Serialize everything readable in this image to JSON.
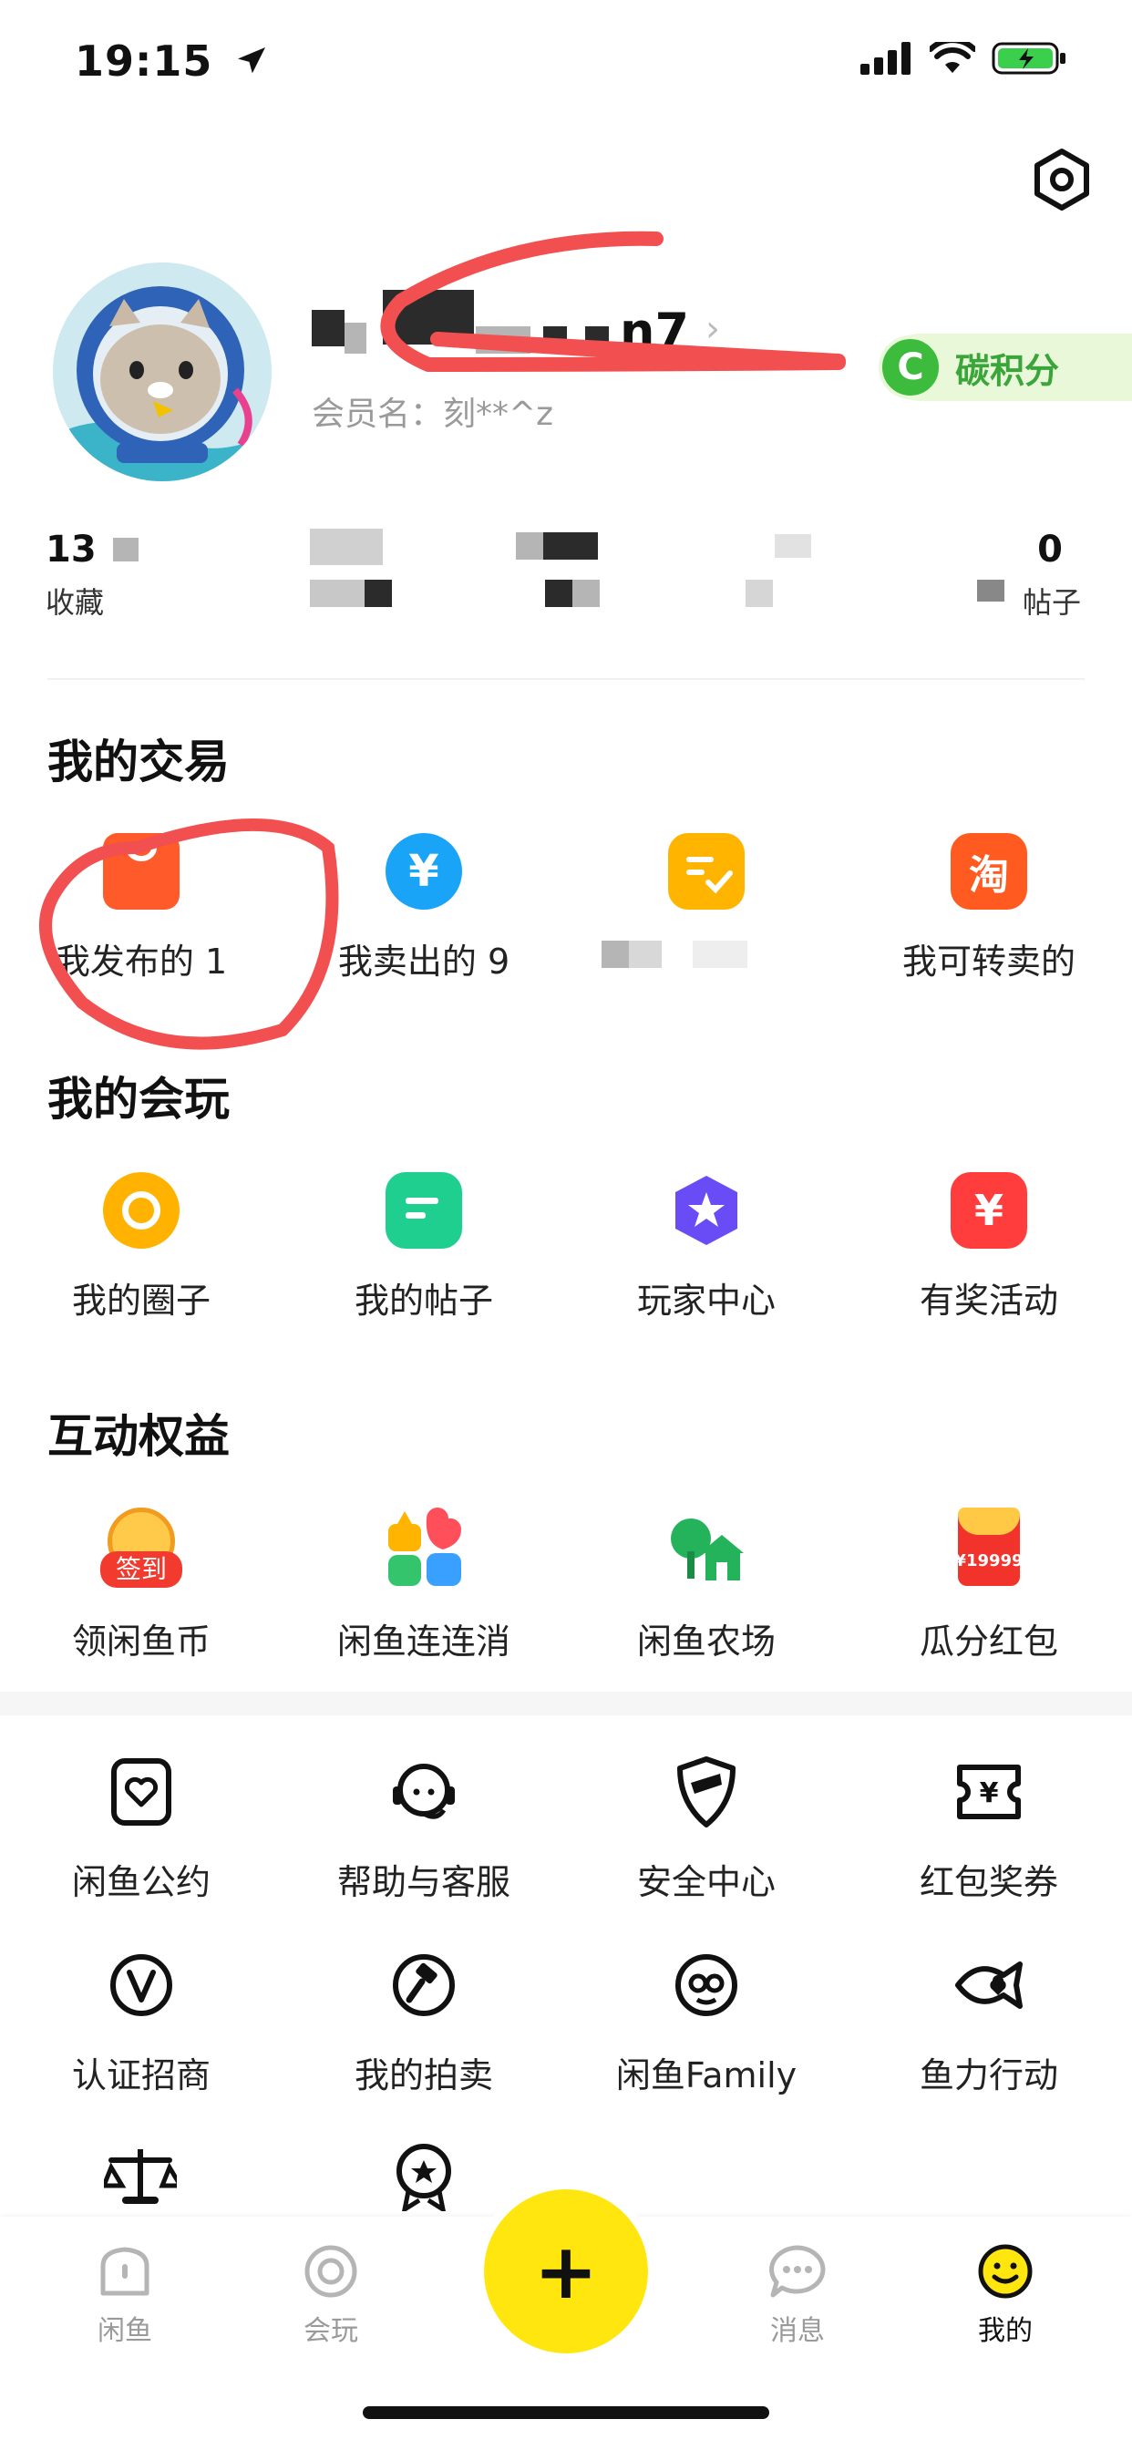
{
  "status_bar": {
    "time": "19:15"
  },
  "profile": {
    "username_visible": "n7",
    "member_name": "会员名：刻**^z",
    "carbon_badge": {
      "icon_letter": "C",
      "label": "碳积分"
    }
  },
  "stats": [
    {
      "num": "13",
      "label": "收藏"
    },
    {
      "num": "",
      "label": ""
    },
    {
      "num": "",
      "label": ""
    },
    {
      "num": "",
      "label": ""
    },
    {
      "num": "0",
      "label": "帖子"
    }
  ],
  "trade": {
    "title": "我的交易",
    "items": [
      {
        "label": "我发布的 1",
        "icon": "bag-icon",
        "color": "#ff5a2a"
      },
      {
        "label": "我卖出的 9",
        "icon": "yen-circle-icon",
        "color": "#1aa4f7"
      },
      {
        "label": "",
        "icon": "checklist-icon",
        "color": "#ffb400"
      },
      {
        "label": "我可转卖的",
        "icon": "taobao-icon",
        "color": "#ff5a1f"
      }
    ]
  },
  "play": {
    "title": "我的会玩",
    "items": [
      {
        "label": "我的圈子",
        "icon": "circle-icon",
        "color": "#ffb300"
      },
      {
        "label": "我的帖子",
        "icon": "post-icon",
        "color": "#1fcf8f"
      },
      {
        "label": "玩家中心",
        "icon": "star-badge-icon",
        "color": "#6a4cf6"
      },
      {
        "label": "有奖活动",
        "icon": "prize-icon",
        "color": "#ff3d3d"
      }
    ]
  },
  "benefits": {
    "title": "互动权益",
    "items": [
      {
        "label": "领闲鱼币",
        "icon": "checkin-coin-icon",
        "badge": "签到"
      },
      {
        "label": "闲鱼连连消",
        "icon": "game-tiles-icon"
      },
      {
        "label": "闲鱼农场",
        "icon": "farm-icon"
      },
      {
        "label": "瓜分红包",
        "icon": "red-envelope-icon",
        "badge": "¥19999"
      }
    ]
  },
  "services": {
    "items": [
      {
        "label": "闲鱼公约",
        "icon": "heart-doc-icon"
      },
      {
        "label": "帮助与客服",
        "icon": "headset-icon"
      },
      {
        "label": "安全中心",
        "icon": "shield-icon"
      },
      {
        "label": "红包奖券",
        "icon": "coupon-icon"
      },
      {
        "label": "认证招商",
        "icon": "verified-v-icon"
      },
      {
        "label": "我的拍卖",
        "icon": "auction-hammer-icon"
      },
      {
        "label": "闲鱼Family",
        "icon": "family-icon"
      },
      {
        "label": "鱼力行动",
        "icon": "fish-icon"
      }
    ]
  },
  "bottom_nav": {
    "items": [
      {
        "label": "闲鱼"
      },
      {
        "label": "会玩"
      },
      {
        "label": "消息"
      },
      {
        "label": "我的"
      }
    ],
    "publish_symbol": "+"
  },
  "colors": {
    "accent_yellow": "#ffe60f",
    "annotation_red": "#f25050"
  }
}
